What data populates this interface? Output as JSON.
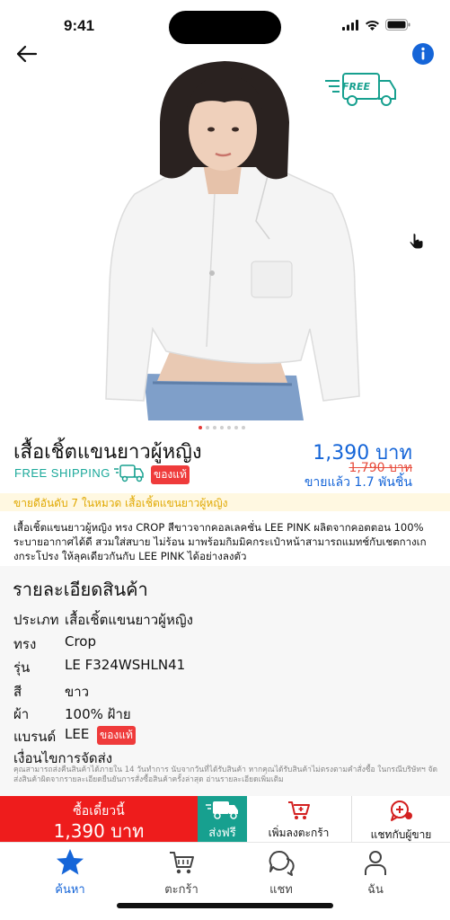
{
  "status_bar": {
    "time": "9:41"
  },
  "product": {
    "title": "เสื้อเชิ้ตแขนยาวผู้หญิง",
    "free_shipping_label": "FREE SHIPPING",
    "authentic_badge": "ของแท้",
    "price": "1,390 บาท",
    "old_price": "1,790 บาท",
    "sold_count": "ขายแล้ว 1.7 พันชิ้น",
    "rank_text": "ขายดีอันดับ 7 ในหมวด เสื้อเชิ้ตแขนยาวผู้หญิง",
    "description": "เสื้อเชิ้ตแขนยาวผู้หญิง ทรง CROP สีขาวจากคอลเลคชั่น LEE PINK ผลิตจากคอตตอน 100% ระบายอากาศได้ดี สวมใส่สบาย ไม่ร้อน มาพร้อมกิมมิคกระเป๋าหน้าสามารถแมทช์กับเชตกางเกงกระโปรง ให้ลุคเดียวกันกับ LEE PINK ได้อย่างลงตัว",
    "free_badge_text": "FREE"
  },
  "details": {
    "heading": "รายละเอียดสินค้า",
    "rows": [
      {
        "label": "ประเภท",
        "value": "เสื้อเชิ้ตแขนยาวผู้หญิง"
      },
      {
        "label": "ทรง",
        "value": "Crop"
      },
      {
        "label": "รุ่น",
        "value": "LE F324WSHLN41"
      },
      {
        "label": "สี",
        "value": "ขาว"
      },
      {
        "label": "ผ้า",
        "value": "100% ฝ้าย"
      },
      {
        "label": "แบรนด์",
        "value": "LEE"
      }
    ],
    "brand_badge": "ของแท้",
    "shipping_heading": "เงื่อนไขการจัดส่ง",
    "shipping_note": "คุณสามารถส่งคืนสินค้าได้ภายใน 14 วันทำการ นับจากวันที่ได้รับสินค้า หากคุณได้รับสินค้าไม่ตรงตามคำสั่งซื้อ ในกรณีบริษัทฯ จัดส่งสินค้าผิดจากรายละเอียดยืนยันการสั่งซื้อสินค้าครั้งล่าสุด อ่านรายละเอียดเพิ่มเติม"
  },
  "actions": {
    "buy_now_label": "ซื้อเดี๋ยวนี้",
    "buy_now_price": "1,390 บาท",
    "free_ship_label": "ส่งฟรี",
    "add_to_cart_label": "เพิ่มลงตะกร้า",
    "chat_seller_label": "แชทกับผู้ขาย"
  },
  "tabs": [
    {
      "label": "ค้นหา",
      "icon": "star-icon",
      "active": true
    },
    {
      "label": "ตะกร้า",
      "icon": "cart-icon",
      "active": false
    },
    {
      "label": "แชท",
      "icon": "chat-icon",
      "active": false
    },
    {
      "label": "ฉัน",
      "icon": "person-icon",
      "active": false
    }
  ],
  "colors": {
    "accent_blue": "#1565d8",
    "buy_red": "#ee1c1c",
    "teal": "#17a08f",
    "badge_red": "#ef3b3b",
    "rank_yellow": "#e0a800"
  },
  "carousel": {
    "total": 7,
    "active_index": 0
  }
}
